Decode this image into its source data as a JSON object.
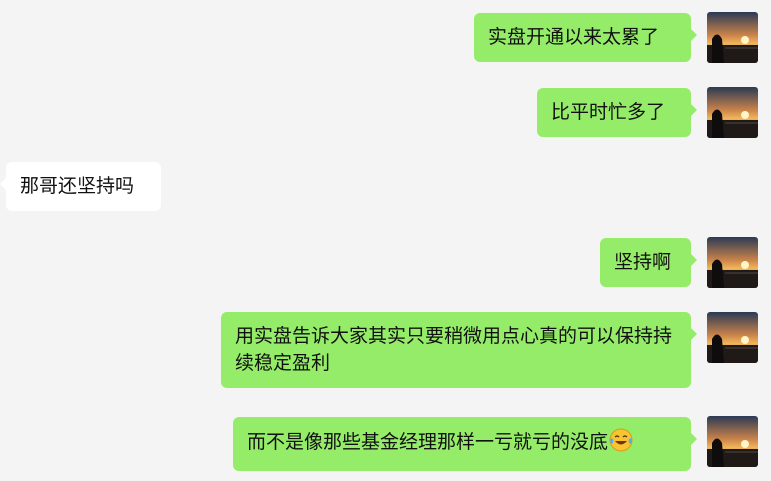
{
  "chat": {
    "messages": [
      {
        "side": "right",
        "text": "实盘开通以来太累了"
      },
      {
        "side": "right",
        "text": "比平时忙多了"
      },
      {
        "side": "left",
        "text": "那哥还坚持吗"
      },
      {
        "side": "right",
        "text": "坚持啊"
      },
      {
        "side": "right",
        "text": "用实盘告诉大家其实只要稍微用点心真的可以保持持续稳定盈利"
      },
      {
        "side": "right",
        "text": "而不是像那些基金经理那样一亏就亏的没底",
        "emoji": "laughing-tears-emoji"
      }
    ]
  },
  "colors": {
    "background": "#f4f4f4",
    "my_bubble": "#95ec69",
    "other_bubble": "#ffffff"
  },
  "icons": {
    "avatar": "sunset-avatar-image",
    "emoji": "laughing-tears-emoji"
  }
}
